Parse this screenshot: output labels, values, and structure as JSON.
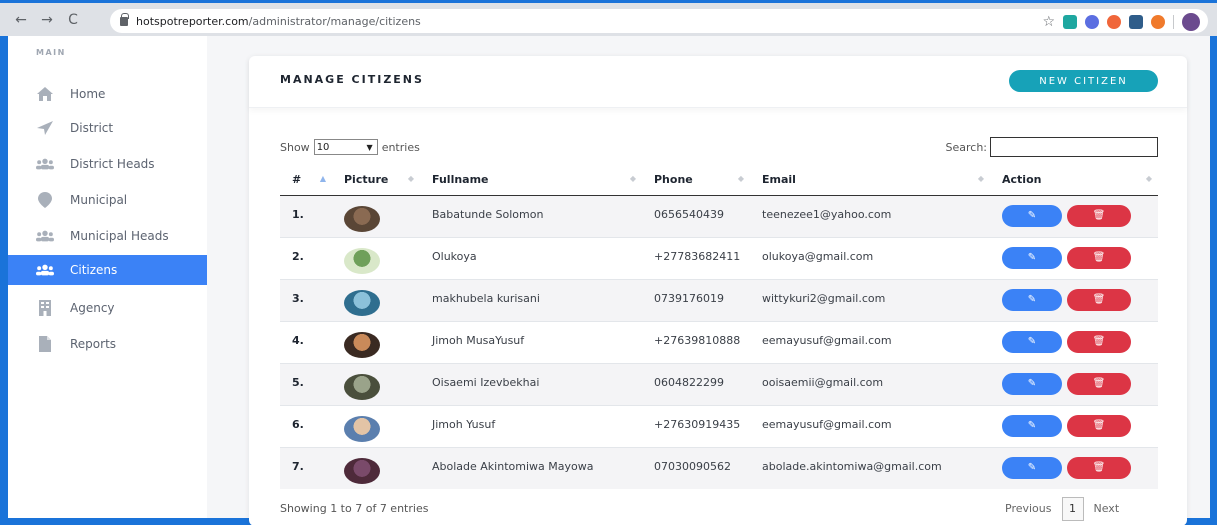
{
  "browser": {
    "back": "←",
    "forward": "→",
    "reload": "C",
    "url_domain": "hotspotreporter.com",
    "url_path": "/administrator/manage/citizens",
    "star": "☆"
  },
  "sidebar": {
    "heading": "MAIN",
    "items": [
      {
        "label": "Home",
        "icon": "home-icon"
      },
      {
        "label": "District",
        "icon": "location-arrow-icon"
      },
      {
        "label": "District Heads",
        "icon": "users-icon"
      },
      {
        "label": "Municipal",
        "icon": "map-marker-icon"
      },
      {
        "label": "Municipal Heads",
        "icon": "users-icon"
      },
      {
        "label": "Citizens",
        "icon": "users-icon",
        "active": true
      },
      {
        "label": "Agency",
        "icon": "building-icon"
      },
      {
        "label": "Reports",
        "icon": "file-icon"
      }
    ]
  },
  "page": {
    "title": "MANAGE CITIZENS",
    "new_button": "NEW CITIZEN"
  },
  "controls": {
    "show_label": "Show",
    "entries_value": "10",
    "entries_label": "entries",
    "search_label": "Search:"
  },
  "table": {
    "headers": [
      "#",
      "Picture",
      "Fullname",
      "Phone",
      "Email",
      "Action"
    ],
    "rows": [
      {
        "num": "1.",
        "name": "Babatunde Solomon",
        "phone": "0656540439",
        "email": "teenezee1@yahoo.com"
      },
      {
        "num": "2.",
        "name": "Olukoya",
        "phone": "+27783682411",
        "email": "olukoya@gmail.com"
      },
      {
        "num": "3.",
        "name": "makhubela kurisani",
        "phone": "0739176019",
        "email": "wittykuri2@gmail.com"
      },
      {
        "num": "4.",
        "name": "Jimoh MusaYusuf",
        "phone": "+27639810888",
        "email": "eemayusuf@gmail.com"
      },
      {
        "num": "5.",
        "name": "Oisaemi Izevbekhai",
        "phone": "0604822299",
        "email": "ooisaemii@gmail.com"
      },
      {
        "num": "6.",
        "name": "Jimoh Yusuf",
        "phone": "+27630919435",
        "email": "eemayusuf@gmail.com"
      },
      {
        "num": "7.",
        "name": "Abolade Akintomiwa Mayowa",
        "phone": "07030090562",
        "email": "abolade.akintomiwa@gmail.com"
      }
    ]
  },
  "footer": {
    "info": "Showing 1 to 7 of 7 entries",
    "previous": "Previous",
    "current_page": "1",
    "next": "Next"
  },
  "colors": {
    "accent": "#3b82f6",
    "teal": "#17a2b8",
    "danger": "#dc3545"
  }
}
